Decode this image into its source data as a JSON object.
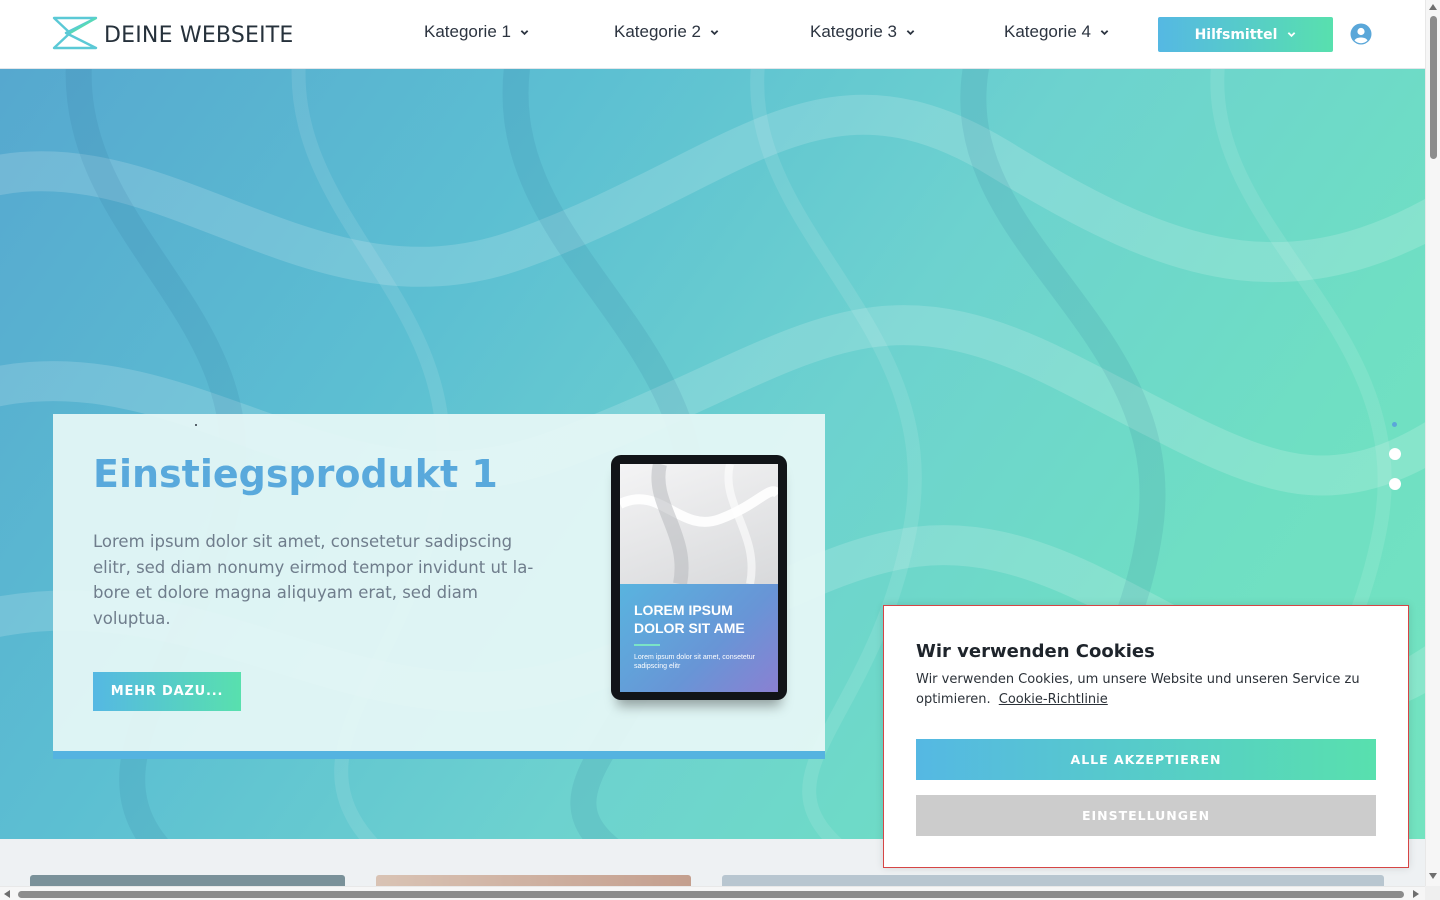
{
  "brand": {
    "name": "DEINE WEBSEITE",
    "logo_icon": "logo-icon",
    "accent_gradient": [
      "#55b8e3",
      "#58e0ae"
    ]
  },
  "nav": {
    "items": [
      {
        "label": "Kategorie 1",
        "icon": "chevron-down-icon"
      },
      {
        "label": "Kategorie 2",
        "icon": "chevron-down-icon"
      },
      {
        "label": "Kategorie 3",
        "icon": "chevron-down-icon"
      },
      {
        "label": "Kategorie 4",
        "icon": "chevron-down-icon"
      }
    ],
    "tools_button": "Hilfsmittel",
    "user_icon": "user-circle-icon"
  },
  "hero": {
    "slide": {
      "title": "Einstiegsprodukt 1",
      "text": "Lorem ipsum dolor sit amet, consetetur sadipscing elitr, sed diam nonumy eirmod tempor invidunt ut la­bore et dolore magna aliquyam erat, sed diam voluptua.",
      "button": "MEHR DAZU...",
      "tablet": {
        "headline": "LOREM IPSUM DOLOR SIT AME",
        "subline": "Lorem ipsum dolor sit amet, consetetur sadipscing elitr"
      }
    },
    "slider_dots": 3,
    "active_dot": 1
  },
  "cookie_banner": {
    "title": "Wir verwenden Cookies",
    "text": "Wir verwenden Cookies, um unsere Website und unseren Service zu optimieren.",
    "link": "Cookie-Richtlinie",
    "accept_button": "ALLE AKZEPTIEREN",
    "settings_button": "EINSTELLUNGEN",
    "border_color": "#d64545"
  }
}
